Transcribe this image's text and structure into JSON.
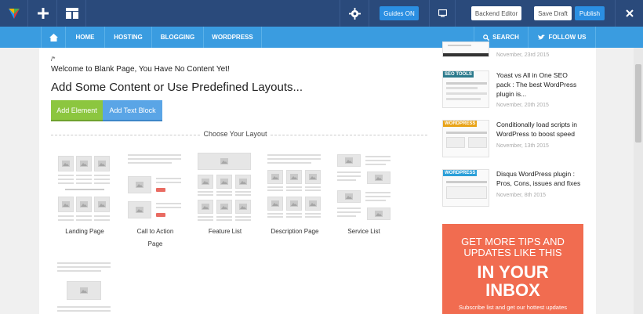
{
  "topbar": {
    "guides_label": "Guides ON",
    "backend_label": "Backend Editor",
    "save_draft_label": "Save Draft",
    "publish_label": "Publish",
    "icons": [
      "logo-icon",
      "add-icon",
      "layout-icon",
      "gear-icon",
      "desktop-icon",
      "close-icon"
    ]
  },
  "nav": {
    "items": [
      "HOME",
      "HOSTING",
      "BLOGGING",
      "WORDPRESS"
    ],
    "search_label": "SEARCH",
    "follow_label": "FOLLOW US",
    "accent": "#3a9ce0"
  },
  "main": {
    "comment_marker": "/*",
    "welcome": "Welcome to Blank Page, You Have No Content Yet!",
    "heading": "Add Some Content or Use Predefined Layouts...",
    "add_element_label": "Add Element",
    "add_text_block_label": "Add Text Block",
    "choose_layout_label": "Choose Your Layout",
    "layouts": [
      {
        "line1": "Landing Page",
        "line2": ""
      },
      {
        "line1": "Call to Action",
        "line2": "Page"
      },
      {
        "line1": "Feature List",
        "line2": ""
      },
      {
        "line1": "Description Page",
        "line2": ""
      },
      {
        "line1": "Service List",
        "line2": ""
      }
    ]
  },
  "sidebar": {
    "posts": [
      {
        "tag": "",
        "title_lines": [],
        "date": "November, 23rd 2015"
      },
      {
        "tag": "SEO TOOLS",
        "title_lines": [
          "Yoast vs All in One SEO",
          "pack : The best WordPress",
          "plugin is..."
        ],
        "date": "November, 20th 2015"
      },
      {
        "tag": "WORDPRESS",
        "title_lines": [
          "Conditionally load scripts in",
          "WordPress to boost speed"
        ],
        "date": "November, 13th 2015"
      },
      {
        "tag": "WORDPRESS",
        "title_lines": [
          "Disqus WordPress plugin :",
          "Pros, Cons, issues and fixes"
        ],
        "date": "November, 8th 2015"
      }
    ],
    "promo": {
      "line1": "GET MORE TIPS AND",
      "line2": "UPDATES LIKE THIS",
      "line3": "IN YOUR",
      "line4": "INBOX",
      "sub": "Subscribe list and get our hottest updates",
      "color": "#f16c50"
    }
  }
}
